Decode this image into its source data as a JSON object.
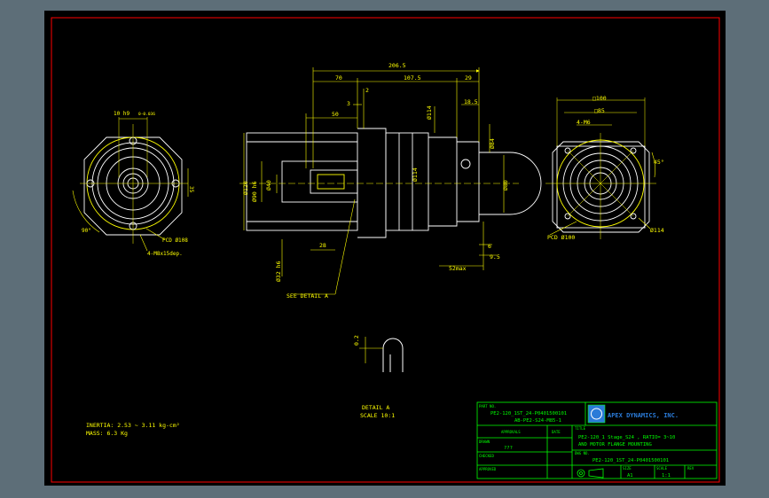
{
  "colors": {
    "background": "#5d6e78",
    "sheet": "#000000",
    "border": "#ff0000",
    "outline": "#ffffff",
    "dimension": "#ffff00",
    "titleblock": "#00ff00",
    "logo": "#2a7bd8"
  },
  "dimensions": {
    "overall": "206.5",
    "d70": "70",
    "d107_5": "107.5",
    "d29": "29",
    "d2": "2",
    "d3": "3",
    "d50": "50",
    "d18_5": "18.5",
    "d114": "Ø114",
    "d84": "Ø84",
    "d80": "Ø80",
    "d120": "Ø120",
    "d90h6": "Ø90 h6",
    "d40": "Ø40",
    "d32h6": "Ø32 h6",
    "d28": "28",
    "d6": "6",
    "d9_5": "9.5",
    "d52max": "52max",
    "key_width": "10 h9",
    "key_tol": "0-0.036",
    "key_35": "35",
    "angle_90": "90°",
    "pcd108": "PCD Ø108",
    "holes_m8": "4-M8x15dep.",
    "sq100": "□100",
    "sq85": "□85",
    "holes_m6": "4-M6",
    "angle_45": "45°",
    "pcd100": "PCD Ø100",
    "d114_right": "Ø114",
    "see_detail": "SEE DETAIL A",
    "detail_02": "0.2",
    "detail_title": "DETAIL A",
    "detail_scale": "SCALE 10:1"
  },
  "notes": {
    "inertia": "INERTIA: 2.53 ~ 3.11 kg-cm²",
    "mass": "MASS: 6.3  Kg"
  },
  "titleblock": {
    "part_no_label": "PART NO.",
    "part_no_1": "PE2-120_1ST_24-P0401500101",
    "part_no_2": "AB-PE2-S24-M85-1",
    "company": "APEX DYNAMICS, INC.",
    "approvals_label": "APPROVALS",
    "date_label": "DATE",
    "drawn_label": "DRAWN",
    "drawn_value": "???",
    "checked_label": "CHECKED",
    "approved_label": "APPROVED",
    "title_label": "TITLE",
    "title_1": "PE2-120_1 Stage_S24 , RATIO= 3~10",
    "title_2": "AND MOTOR FLANGE MOUNTING",
    "dwg_no_label": "DWG NO.",
    "dwg_no": "PE2-120_1ST_24-P0401500101",
    "size_label": "SIZE",
    "size_value": "A1",
    "scale_label": "SCALE",
    "scale_value": "1:1",
    "rev_label": "REV"
  }
}
